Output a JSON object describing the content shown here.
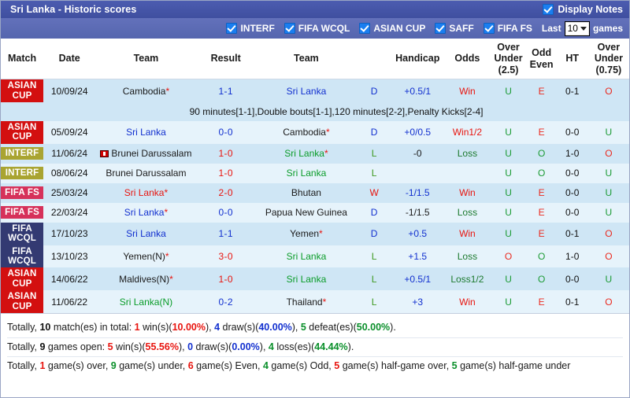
{
  "header": {
    "title": "Sri Lanka - Historic scores",
    "display_notes_label": "Display Notes",
    "display_notes_checked": true
  },
  "filters": {
    "checkboxes": [
      {
        "label": "INTERF",
        "checked": true
      },
      {
        "label": "FIFA WCQL",
        "checked": true
      },
      {
        "label": "ASIAN CUP",
        "checked": true
      },
      {
        "label": "SAFF",
        "checked": true
      },
      {
        "label": "FIFA FS",
        "checked": true
      }
    ],
    "last_label": "Last",
    "games_label": "games",
    "last_games_value": "10"
  },
  "table": {
    "columns": [
      {
        "key": "match",
        "label": "Match"
      },
      {
        "key": "date",
        "label": "Date"
      },
      {
        "key": "team_home",
        "label": "Team"
      },
      {
        "key": "result",
        "label": "Result"
      },
      {
        "key": "team_away",
        "label": "Team"
      },
      {
        "key": "wdl",
        "label": ""
      },
      {
        "key": "handicap",
        "label": "Handicap"
      },
      {
        "key": "odds",
        "label": "Odds"
      },
      {
        "key": "over_under_25",
        "label": "Over Under (2.5)"
      },
      {
        "key": "odd_even",
        "label": "Odd Even"
      },
      {
        "key": "ht",
        "label": "HT"
      },
      {
        "key": "over_under_075",
        "label": "Over Under (0.75)"
      }
    ],
    "column_labels": {
      "over_under_25_l1": "Over",
      "over_under_25_l2": "Under",
      "over_under_25_l3": "(2.5)",
      "odd_even_l1": "Odd",
      "odd_even_l2": "Even",
      "over_under_075_l1": "Over",
      "over_under_075_l2": "Under",
      "over_under_075_l3": "(0.75)"
    },
    "rows": [
      {
        "comp": "ASIAN CUP",
        "comp_l1": "ASIAN",
        "comp_l2": "CUP",
        "comp_color": "#d31010",
        "date": "10/09/24",
        "home": "Cambodia",
        "home_star": true,
        "home_color": "#1a1a1a",
        "result": "1-1",
        "result_color": "#1230cf",
        "away": "Sri Lanka",
        "away_star": false,
        "away_color": "#1230cf",
        "wdl": "D",
        "wdl_color": "#1230cf",
        "handicap": "+0.5/1",
        "handicap_color": "#1230cf",
        "odds": "Win",
        "odds_color": "#e8150f",
        "ou25": "U",
        "ou25_color": "#1c9b35",
        "oddeven": "E",
        "oddeven_color": "#ea2a1f",
        "ht": "0-1",
        "ou075": "O",
        "ou075_color": "#ea2a1f",
        "note": "90 minutes[1-1],Double bouts[1-1],120 minutes[2-2],Penalty Kicks[2-4]"
      },
      {
        "comp": "ASIAN CUP",
        "comp_l1": "ASIAN",
        "comp_l2": "CUP",
        "comp_color": "#d31010",
        "date": "05/09/24",
        "home": "Sri Lanka",
        "home_star": false,
        "home_color": "#1230cf",
        "result": "0-0",
        "result_color": "#1230cf",
        "away": "Cambodia",
        "away_star": true,
        "away_color": "#1a1a1a",
        "wdl": "D",
        "wdl_color": "#1230cf",
        "handicap": "+0/0.5",
        "handicap_color": "#1230cf",
        "odds": "Win1/2",
        "odds_color": "#e8150f",
        "ou25": "U",
        "ou25_color": "#1c9b35",
        "oddeven": "E",
        "oddeven_color": "#ea2a1f",
        "ht": "0-0",
        "ou075": "U",
        "ou075_color": "#1c9b35",
        "note": ""
      },
      {
        "comp": "INTERF",
        "comp_l1": "INTERF",
        "comp_l2": "",
        "comp_color": "#a9a431",
        "date": "11/06/24",
        "home": "Brunei Darussalam",
        "home_star": false,
        "home_color": "#1a1a1a",
        "home_icon": "red-flag-icon",
        "result": "1-0",
        "result_color": "#e8150f",
        "away": "Sri Lanka",
        "away_star": true,
        "away_color": "#0a9c29",
        "wdl": "L",
        "wdl_color": "#3f9a22",
        "handicap": "-0",
        "handicap_color": "#1a1a1a",
        "odds": "Loss",
        "odds_color": "#1d7a2f",
        "ou25": "U",
        "ou25_color": "#1c9b35",
        "oddeven": "O",
        "oddeven_color": "#1c9b35",
        "ht": "1-0",
        "ou075": "O",
        "ou075_color": "#ea2a1f",
        "note": ""
      },
      {
        "comp": "INTERF",
        "comp_l1": "INTERF",
        "comp_l2": "",
        "comp_color": "#a9a431",
        "date": "08/06/24",
        "home": "Brunei Darussalam",
        "home_star": false,
        "home_color": "#1a1a1a",
        "result": "1-0",
        "result_color": "#e8150f",
        "away": "Sri Lanka",
        "away_star": false,
        "away_color": "#0a9c29",
        "wdl": "L",
        "wdl_color": "#3f9a22",
        "handicap": "",
        "handicap_color": "#1a1a1a",
        "odds": "",
        "odds_color": "#1a1a1a",
        "ou25": "U",
        "ou25_color": "#1c9b35",
        "oddeven": "O",
        "oddeven_color": "#1c9b35",
        "ht": "0-0",
        "ou075": "U",
        "ou075_color": "#1c9b35",
        "note": ""
      },
      {
        "comp": "FIFA FS",
        "comp_l1": "FIFA FS",
        "comp_l2": "",
        "comp_color": "#d6315a",
        "date": "25/03/24",
        "home": "Sri Lanka",
        "home_star": true,
        "home_color": "#e8150f",
        "result": "2-0",
        "result_color": "#e8150f",
        "away": "Bhutan",
        "away_star": false,
        "away_color": "#1a1a1a",
        "wdl": "W",
        "wdl_color": "#e8150f",
        "handicap": "-1/1.5",
        "handicap_color": "#1230cf",
        "odds": "Win",
        "odds_color": "#e8150f",
        "ou25": "U",
        "ou25_color": "#1c9b35",
        "oddeven": "E",
        "oddeven_color": "#ea2a1f",
        "ht": "0-0",
        "ou075": "U",
        "ou075_color": "#1c9b35",
        "note": ""
      },
      {
        "comp": "FIFA FS",
        "comp_l1": "FIFA FS",
        "comp_l2": "",
        "comp_color": "#d6315a",
        "date": "22/03/24",
        "home": "Sri Lanka",
        "home_star": true,
        "home_color": "#1230cf",
        "result": "0-0",
        "result_color": "#1230cf",
        "away": "Papua New Guinea",
        "away_star": false,
        "away_color": "#1a1a1a",
        "wdl": "D",
        "wdl_color": "#1230cf",
        "handicap": "-1/1.5",
        "handicap_color": "#1a1a1a",
        "odds": "Loss",
        "odds_color": "#1d7a2f",
        "ou25": "U",
        "ou25_color": "#1c9b35",
        "oddeven": "E",
        "oddeven_color": "#ea2a1f",
        "ht": "0-0",
        "ou075": "U",
        "ou075_color": "#1c9b35",
        "note": ""
      },
      {
        "comp": "FIFA WCQL",
        "comp_l1": "FIFA",
        "comp_l2": "WCQL",
        "comp_color": "#333a72",
        "date": "17/10/23",
        "home": "Sri Lanka",
        "home_star": false,
        "home_color": "#1230cf",
        "result": "1-1",
        "result_color": "#1230cf",
        "away": "Yemen",
        "away_star": true,
        "away_color": "#1a1a1a",
        "wdl": "D",
        "wdl_color": "#1230cf",
        "handicap": "+0.5",
        "handicap_color": "#1230cf",
        "odds": "Win",
        "odds_color": "#e8150f",
        "ou25": "U",
        "ou25_color": "#1c9b35",
        "oddeven": "E",
        "oddeven_color": "#ea2a1f",
        "ht": "0-1",
        "ou075": "O",
        "ou075_color": "#ea2a1f",
        "note": ""
      },
      {
        "comp": "FIFA WCQL",
        "comp_l1": "FIFA",
        "comp_l2": "WCQL",
        "comp_color": "#333a72",
        "date": "13/10/23",
        "home": "Yemen(N)",
        "home_star": true,
        "home_color": "#1a1a1a",
        "result": "3-0",
        "result_color": "#e8150f",
        "away": "Sri Lanka",
        "away_star": false,
        "away_color": "#0a9c29",
        "wdl": "L",
        "wdl_color": "#3f9a22",
        "handicap": "+1.5",
        "handicap_color": "#1230cf",
        "odds": "Loss",
        "odds_color": "#1d7a2f",
        "ou25": "O",
        "ou25_color": "#ea2a1f",
        "oddeven": "O",
        "oddeven_color": "#1c9b35",
        "ht": "1-0",
        "ou075": "O",
        "ou075_color": "#ea2a1f",
        "note": ""
      },
      {
        "comp": "ASIAN CUP",
        "comp_l1": "ASIAN",
        "comp_l2": "CUP",
        "comp_color": "#d31010",
        "date": "14/06/22",
        "home": "Maldives(N)",
        "home_star": true,
        "home_color": "#1a1a1a",
        "result": "1-0",
        "result_color": "#e8150f",
        "away": "Sri Lanka",
        "away_star": false,
        "away_color": "#0a9c29",
        "wdl": "L",
        "wdl_color": "#3f9a22",
        "handicap": "+0.5/1",
        "handicap_color": "#1230cf",
        "odds": "Loss1/2",
        "odds_color": "#1d7a2f",
        "ou25": "U",
        "ou25_color": "#1c9b35",
        "oddeven": "O",
        "oddeven_color": "#1c9b35",
        "ht": "0-0",
        "ou075": "U",
        "ou075_color": "#1c9b35",
        "note": ""
      },
      {
        "comp": "ASIAN CUP",
        "comp_l1": "ASIAN",
        "comp_l2": "CUP",
        "comp_color": "#d31010",
        "date": "11/06/22",
        "home": "Sri Lanka(N)",
        "home_star": false,
        "home_color": "#0a9c29",
        "result": "0-2",
        "result_color": "#1230cf",
        "away": "Thailand",
        "away_star": true,
        "away_color": "#1a1a1a",
        "wdl": "L",
        "wdl_color": "#3f9a22",
        "handicap": "+3",
        "handicap_color": "#1230cf",
        "odds": "Win",
        "odds_color": "#e8150f",
        "ou25": "U",
        "ou25_color": "#1c9b35",
        "oddeven": "E",
        "oddeven_color": "#ea2a1f",
        "ht": "0-1",
        "ou075": "O",
        "ou075_color": "#ea2a1f",
        "note": ""
      }
    ]
  },
  "summary": {
    "line1": {
      "p0": "Totally, ",
      "v1": "10",
      "p1": " match(es) in total: ",
      "v2": "1",
      "p2": " win(s)(",
      "v3": "10.00%",
      "p3": "), ",
      "v4": "4",
      "p4": " draw(s)(",
      "v5": "40.00%",
      "p5": "), ",
      "v6": "5",
      "p6": " defeat(es)(",
      "v7": "50.00%",
      "p7": ")."
    },
    "line2": {
      "p0": "Totally, ",
      "v1": "9",
      "p1": " games open: ",
      "v2": "5",
      "p2": " win(s)(",
      "v3": "55.56%",
      "p3": "), ",
      "v4": "0",
      "p4": " draw(s)(",
      "v5": "0.00%",
      "p5": "), ",
      "v6": "4",
      "p6": " loss(es)(",
      "v7": "44.44%",
      "p7": ")."
    },
    "line3": {
      "p0": "Totally, ",
      "v1": "1",
      "p1": " game(s) over, ",
      "v2": "9",
      "p2": " game(s) under, ",
      "v3": "6",
      "p3": " game(s) Even, ",
      "v4": "4",
      "p4": " game(s) Odd, ",
      "v5": "5",
      "p5": " game(s) half-game over, ",
      "v6": "5",
      "p6": " game(s) half-game under"
    }
  }
}
